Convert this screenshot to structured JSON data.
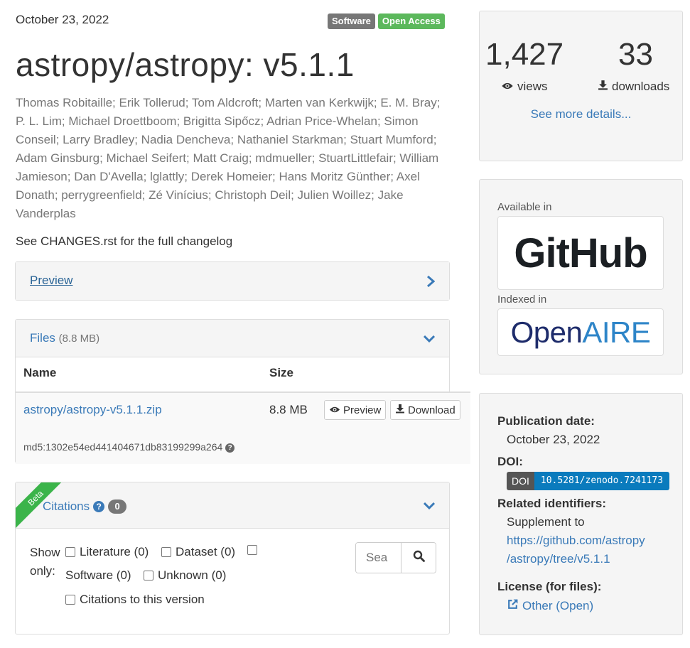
{
  "record": {
    "date": "October 23, 2022",
    "badges": {
      "type": "Software",
      "access": "Open Access"
    },
    "title": "astropy/astropy: v5.1.1",
    "authors": "Thomas Robitaille; Erik Tollerud; Tom Aldcroft; Marten van Kerkwijk; E. M. Bray; P. L. Lim; Michael Droettboom; Brigitta Sipőcz; Adrian Price-Whelan; Simon Conseil; Larry Bradley; Nadia Dencheva; Nathaniel Starkman; Stuart Mumford; Adam Ginsburg; Michael Seifert; Matt Craig; mdmueller; StuartLittlefair; William Jamieson; Dan D'Avella; lglattly; Derek Homeier; Hans Moritz Günther; Axel Donath; perrygreenfield; Zé Vinícius; Christoph Deil; Julien Woillez; Jake Vanderplas",
    "description": "See CHANGES.rst for the full changelog"
  },
  "preview_panel": {
    "label": "Preview"
  },
  "files_panel": {
    "title": "Files",
    "total_size": "(8.8 MB)",
    "columns": [
      "Name",
      "Size"
    ],
    "file": {
      "name": "astropy/astropy-v5.1.1.zip",
      "size": "8.8 MB",
      "md5": "md5:1302e54ed441404671db83199299a264",
      "preview_label": "Preview",
      "download_label": "Download"
    }
  },
  "citations_panel": {
    "ribbon": "Beta",
    "title": "Citations",
    "count": "0",
    "show_only": "Show only:",
    "filters": {
      "literature": "Literature (0)",
      "dataset": "Dataset (0)",
      "software": "Software (0)",
      "unknown": "Unknown (0)",
      "this_version": "Citations to this version"
    },
    "search_placeholder": "Sea"
  },
  "stats": {
    "views": "1,427",
    "views_label": "views",
    "downloads": "33",
    "downloads_label": "downloads",
    "more_link": "See more details..."
  },
  "availability": {
    "available_label": "Available in",
    "github_logo": "GitHub",
    "indexed_label": "Indexed in",
    "openaire_logo_open": "Open",
    "openaire_logo_aire": "AIRE"
  },
  "metadata": {
    "pub_date_label": "Publication date:",
    "pub_date": "October 23, 2022",
    "doi_label": "DOI:",
    "doi_prefix": "DOI",
    "doi": "10.5281/zenodo.7241173",
    "related_label": "Related identifiers:",
    "related_rel": "Supplement to",
    "related_url_1": "https://github.com/astropy",
    "related_url_2": "/astropy/tree/v5.1.1",
    "license_label": "License (for files):",
    "license": "Other (Open)"
  }
}
